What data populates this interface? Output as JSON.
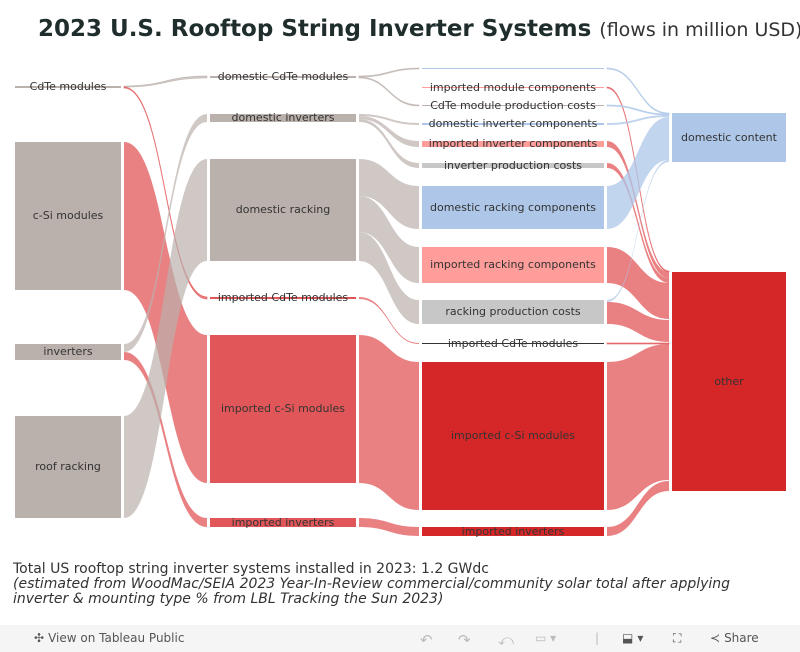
{
  "title": "2023 U.S. Rooftop String Inverter Systems",
  "subtitle": "(flows in million USD)",
  "colors": {
    "gray": "#bab0ac",
    "red": "#e15759",
    "dark_red": "#d62728",
    "pink": "#ff9d9a",
    "blue": "#aec7e8"
  },
  "nodes": {
    "cdte_modules": {
      "label": "CdTe modules",
      "color": "#bab0ac"
    },
    "csi_modules": {
      "label": "c-Si modules",
      "color": "#bab0ac"
    },
    "inverters": {
      "label": "inverters",
      "color": "#bab0ac"
    },
    "roof_racking": {
      "label": "roof racking",
      "color": "#bab0ac"
    },
    "dom_cdte": {
      "label": "domestic CdTe modules",
      "color": "#bab0ac"
    },
    "dom_inv": {
      "label": "domestic inverters",
      "color": "#bab0ac"
    },
    "dom_rack": {
      "label": "domestic racking",
      "color": "#bab0ac"
    },
    "imp_cdte": {
      "label": "imported CdTe modules",
      "color": "#e15759"
    },
    "imp_csi": {
      "label": "imported c-Si modules",
      "color": "#e15759"
    },
    "imp_inv": {
      "label": "imported inverters",
      "color": "#e15759"
    },
    "dom_mod_comp": {
      "label": "",
      "color": "#aec7e8"
    },
    "imp_mod_comp": {
      "label": "imported module components",
      "color": "#ff9d9a"
    },
    "cdte_prod": {
      "label": "CdTe module production costs",
      "color": "#bab0ac"
    },
    "dom_inv_comp": {
      "label": "domestic inverter components",
      "color": "#aec7e8"
    },
    "imp_inv_comp": {
      "label": "imported inverter components",
      "color": "#ff9d9a"
    },
    "inv_prod": {
      "label": "inverter production costs",
      "color": "#c7c7c7"
    },
    "dom_rack_comp": {
      "label": "domestic racking components",
      "color": "#aec7e8"
    },
    "imp_rack_comp": {
      "label": "imported racking components",
      "color": "#ff9d9a"
    },
    "rack_prod": {
      "label": "racking production costs",
      "color": "#c7c7c7"
    },
    "imp_cdte2": {
      "label": "imported CdTe modules",
      "color": "#333333"
    },
    "imp_csi2": {
      "label": "imported c-Si modules",
      "color": "#d62728"
    },
    "imp_inv2": {
      "label": "imported inverters",
      "color": "#d62728"
    },
    "dom_content": {
      "label": "domestic content",
      "color": "#aec7e8"
    },
    "other": {
      "label": "other",
      "color": "#d62728"
    }
  },
  "links": [
    {
      "source": "cdte_modules",
      "target": "dom_cdte",
      "color": "gray"
    },
    {
      "source": "cdte_modules",
      "target": "imp_cdte",
      "color": "red"
    },
    {
      "source": "csi_modules",
      "target": "imp_csi",
      "color": "red"
    },
    {
      "source": "inverters",
      "target": "dom_inv",
      "color": "gray"
    },
    {
      "source": "inverters",
      "target": "imp_inv",
      "color": "red"
    },
    {
      "source": "roof_racking",
      "target": "dom_rack",
      "color": "gray"
    },
    {
      "source": "dom_cdte",
      "target": "dom_mod_comp",
      "color": "gray"
    },
    {
      "source": "dom_cdte",
      "target": "cdte_prod",
      "color": "gray"
    },
    {
      "source": "dom_inv",
      "target": "dom_inv_comp",
      "color": "gray"
    },
    {
      "source": "dom_inv",
      "target": "imp_inv_comp",
      "color": "gray"
    },
    {
      "source": "dom_inv",
      "target": "inv_prod",
      "color": "gray"
    },
    {
      "source": "dom_rack",
      "target": "dom_rack_comp",
      "color": "gray"
    },
    {
      "source": "dom_rack",
      "target": "imp_rack_comp",
      "color": "gray"
    },
    {
      "source": "dom_rack",
      "target": "rack_prod",
      "color": "gray"
    },
    {
      "source": "imp_cdte",
      "target": "imp_cdte2",
      "color": "red"
    },
    {
      "source": "imp_csi",
      "target": "imp_csi2",
      "color": "red"
    },
    {
      "source": "imp_inv",
      "target": "imp_inv2",
      "color": "red"
    },
    {
      "source": "dom_mod_comp",
      "target": "dom_content",
      "color": "blue"
    },
    {
      "source": "imp_mod_comp",
      "target": "other",
      "color": "red"
    },
    {
      "source": "cdte_prod",
      "target": "dom_content",
      "color": "blue"
    },
    {
      "source": "dom_inv_comp",
      "target": "dom_content",
      "color": "blue"
    },
    {
      "source": "imp_inv_comp",
      "target": "other",
      "color": "red"
    },
    {
      "source": "inv_prod",
      "target": "other",
      "color": "red"
    },
    {
      "source": "dom_rack_comp",
      "target": "dom_content",
      "color": "blue"
    },
    {
      "source": "imp_rack_comp",
      "target": "other",
      "color": "red"
    },
    {
      "source": "rack_prod",
      "target": "dom_content",
      "color": "blue"
    },
    {
      "source": "rack_prod",
      "target": "other",
      "color": "red"
    },
    {
      "source": "imp_cdte2",
      "target": "other",
      "color": "red"
    },
    {
      "source": "imp_csi2",
      "target": "other",
      "color": "red"
    },
    {
      "source": "imp_inv2",
      "target": "other",
      "color": "red"
    }
  ],
  "note": {
    "line1": "Total US rooftop string inverter systems installed in 2023: 1.2 GWdc",
    "line2": "(estimated from WoodMac/SEIA 2023 Year-In-Review commercial/community solar total after applying inverter & mounting type % from LBL Tracking the Sun 2023)"
  },
  "toolbar": {
    "view_label": "View on Tableau Public",
    "share_label": "Share"
  }
}
